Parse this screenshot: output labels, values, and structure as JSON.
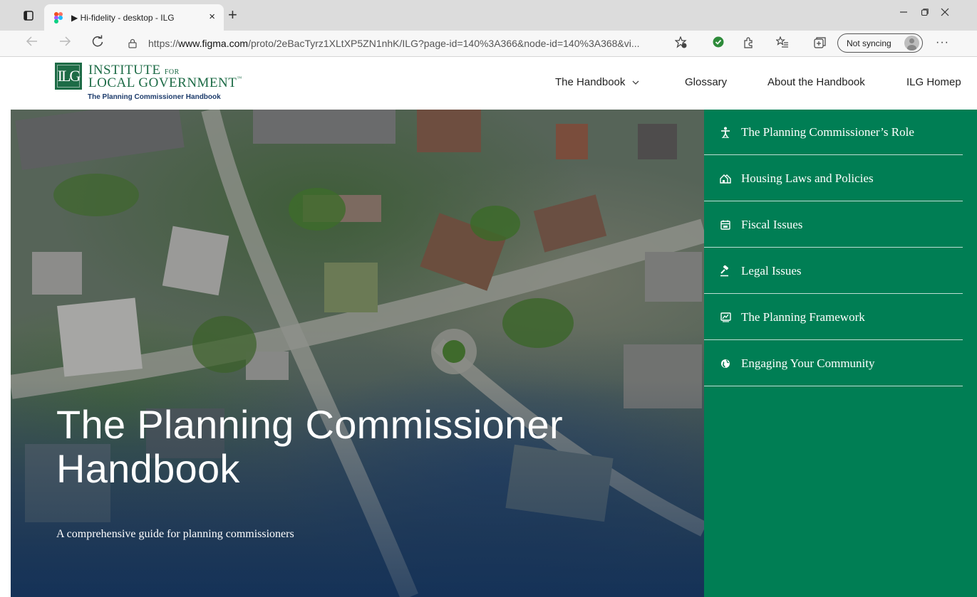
{
  "browser": {
    "tab_title": "▶ Hi-fidelity - desktop - ILG",
    "url_prefix": "https://",
    "url_domain": "www.figma.com",
    "url_path": "/proto/2eBacTyrz1XLtXP5ZN1nhK/ILG?page-id=140%3A366&node-id=140%3A368&vi...",
    "sync_label": "Not syncing",
    "new_tab_glyph": "+",
    "close_glyph": "×",
    "more_glyph": "···"
  },
  "header": {
    "logo_mark": "ILG",
    "logo_line1": "INSTITUTE",
    "logo_for": "FOR",
    "logo_line2": "LOCAL GOVERNMENT",
    "logo_tm": "™",
    "logo_sub": "The Planning Commissioner Handbook",
    "nav": [
      {
        "label": "The Handbook",
        "has_dropdown": true
      },
      {
        "label": "Glossary"
      },
      {
        "label": "About the Handbook"
      },
      {
        "label": "ILG Homep"
      }
    ]
  },
  "hero": {
    "title_line1": "The Planning Commissioner",
    "title_line2": "Handbook",
    "subtitle": "A comprehensive guide for planning commissioners"
  },
  "side_menu": {
    "items": [
      {
        "label": "The Planning Commissioner’s Role",
        "icon": "person-icon"
      },
      {
        "label": "Housing Laws and Policies",
        "icon": "houses-icon"
      },
      {
        "label": "Fiscal Issues",
        "icon": "calendar-icon"
      },
      {
        "label": "Legal Issues",
        "icon": "gavel-icon"
      },
      {
        "label": "The Planning Framework",
        "icon": "map-icon"
      },
      {
        "label": "Engaging Your Community",
        "icon": "globe-icon"
      }
    ]
  },
  "colors": {
    "brand_green": "#007e54",
    "logo_green": "#1d6b46",
    "logo_sub_navy": "#1c3b6b"
  }
}
